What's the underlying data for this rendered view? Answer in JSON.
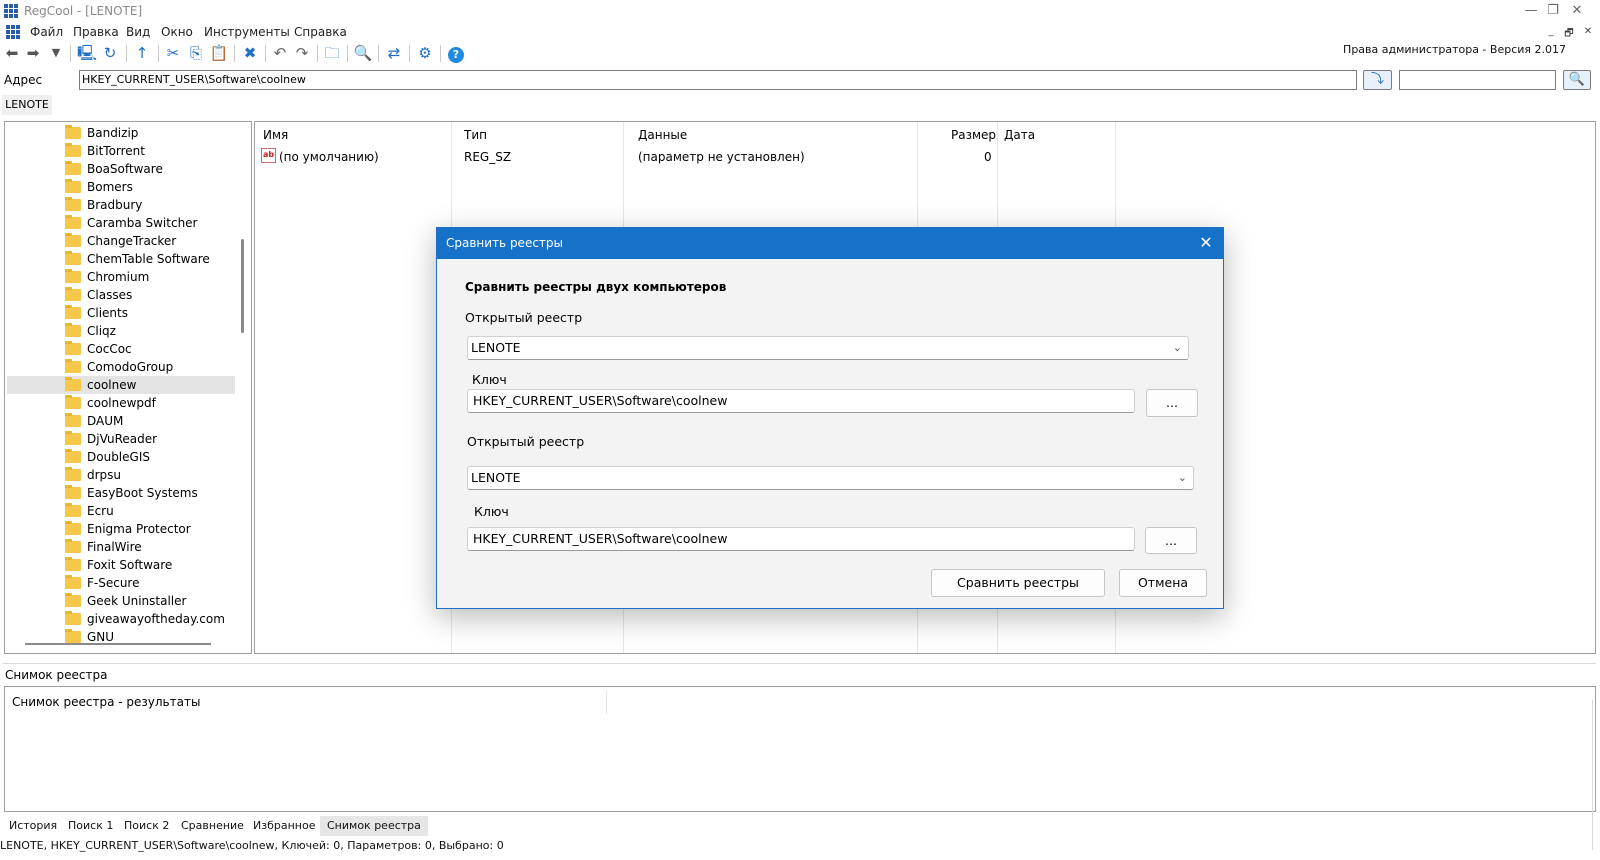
{
  "window": {
    "title": "RegCool - [LENOTE]",
    "controls": {
      "minimize": "—",
      "restore": "❐",
      "close": "✕"
    }
  },
  "menubar": {
    "items": [
      "Файл",
      "Правка",
      "Вид",
      "Окно",
      "Инструменты",
      "Справка"
    ],
    "mdi_controls": {
      "minimize": "_",
      "restore": "🗗",
      "close": "✕"
    }
  },
  "toolbar": {
    "icons": [
      "back-icon",
      "forward-icon",
      "dropdown-icon",
      "computer-icon",
      "refresh-icon",
      "up-icon",
      "cut-icon",
      "copy-icon",
      "paste-icon",
      "delete-icon",
      "undo-icon",
      "redo-icon",
      "new-key-icon",
      "find-icon",
      "compare-icon",
      "settings-icon",
      "help-icon"
    ],
    "rights_text": "Права администратора - Версия 2.017"
  },
  "address": {
    "label": "Адрес",
    "value": "HKEY_CURRENT_USER\\Software\\coolnew",
    "search_value": ""
  },
  "host_tab": "LENOTE",
  "tree": {
    "items": [
      "Bandizip",
      "BitTorrent",
      "BoaSoftware",
      "Bomers",
      "Bradbury",
      "Caramba Switcher",
      "ChangeTracker",
      "ChemTable Software",
      "Chromium",
      "Classes",
      "Clients",
      "Cliqz",
      "CocCoc",
      "ComodoGroup",
      "coolnew",
      "coolnewpdf",
      "DAUM",
      "DjVuReader",
      "DoubleGIS",
      "drpsu",
      "EasyBoot Systems",
      "Ecru",
      "Enigma Protector",
      "FinalWire",
      "Foxit Software",
      "F-Secure",
      "Geek Uninstaller",
      "giveawayoftheday.com",
      "GNU"
    ],
    "selected": "coolnew"
  },
  "list": {
    "columns": {
      "name": "Имя",
      "type": "Тип",
      "data": "Данные",
      "size": "Размер",
      "date": "Дата"
    },
    "rows": [
      {
        "name": "(по умолчанию)",
        "type": "REG_SZ",
        "data": "(параметр не установлен)",
        "size": "0",
        "date": ""
      }
    ]
  },
  "snapshot": {
    "panel_label": "Снимок реестра",
    "result_text": "Снимок реестра - результаты"
  },
  "bottom_tabs": [
    "История",
    "Поиск 1",
    "Поиск 2",
    "Сравнение",
    "Избранное",
    "Снимок реестра"
  ],
  "active_bottom_tab": "Снимок реестра",
  "statusbar": "LENOTE, HKEY_CURRENT_USER\\Software\\coolnew, Ключей: 0, Параметров: 0, Выбрано: 0",
  "dialog": {
    "title": "Сравнить реестры",
    "heading": "Сравнить реестры двух компьютеров",
    "first": {
      "registry_label": "Открытый реестр",
      "registry_value": "LENOTE",
      "key_label": "Ключ",
      "key_value": "HKEY_CURRENT_USER\\Software\\coolnew",
      "browse_label": "..."
    },
    "second": {
      "registry_label": "Открытый реестр",
      "registry_value": "LENOTE",
      "key_label": "Ключ",
      "key_value": "HKEY_CURRENT_USER\\Software\\coolnew",
      "browse_label": "..."
    },
    "compare_button": "Сравнить реестры",
    "cancel_button": "Отмена",
    "close_glyph": "✕"
  },
  "colors": {
    "accent": "#1672c8",
    "folder": "#f5c84b",
    "selection": "#e4e4e4"
  }
}
